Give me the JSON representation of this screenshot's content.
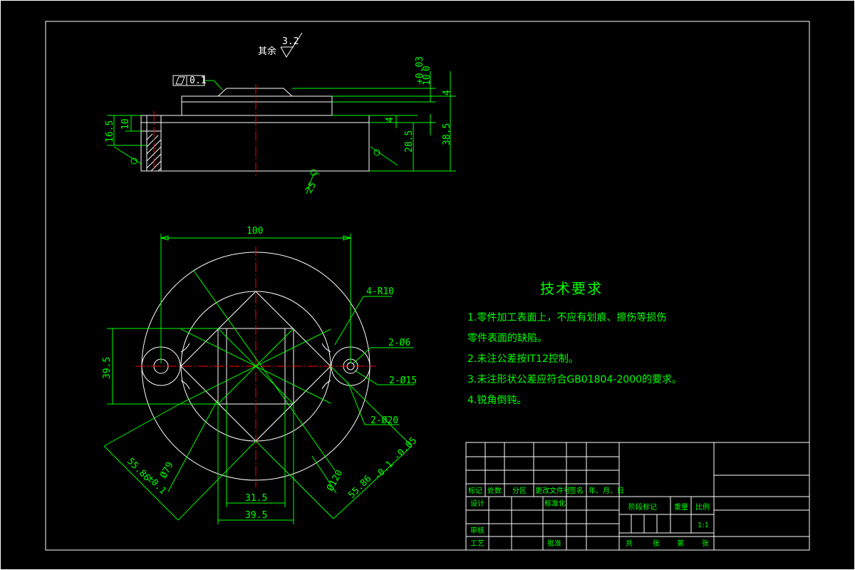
{
  "top_view": {
    "roughness_other_label": "其余",
    "roughness_value": "3.2",
    "flatness_value": "0.1",
    "dim_10_tol": "10",
    "dim_tol_upper": "+0.03",
    "dim_tol_lower": "0",
    "dim_4_top": "4",
    "dim_4_mid": "4",
    "dim_16_5": "16.5",
    "dim_10_left": "10",
    "dim_28_5": "28.5",
    "dim_38_5": "38.5",
    "angle_25": "25"
  },
  "plan_view": {
    "dim_100": "100",
    "dim_4_r10": "4-R10",
    "dim_2_phi6": "2-Ø6",
    "dim_2_phi15": "2-Ø15",
    "dim_2_phi20": "2-Ø20",
    "dim_39_5_left": "39.5",
    "dim_phi79": "Ø79",
    "dim_phi120": "Ø120",
    "dim_55_86_left": "55.86",
    "dim_55_86_left_tol": "±0.1",
    "dim_55_86_right": "55.86",
    "dim_55_86_right_tol": "-0.1 -0.05",
    "dim_31_5": "31.5",
    "dim_39_5_bottom": "39.5"
  },
  "technical_requirements": {
    "title": "技术要求",
    "items": [
      "1.零件加工表面上，不应有划痕、擦伤等损伤",
      "零件表面的缺陷。",
      "2.未注公差按IT12控制。",
      "3.未注形状公差应符合GB01804-2000的要求。",
      "4.锐角倒钝。"
    ]
  },
  "title_block": {
    "biaoji": "标记",
    "chushu": "处数",
    "fenqu": "分区",
    "gengai": "更改文件号",
    "qianming": "签名",
    "date": "年、月、日",
    "sheji": "设计",
    "biaozhunhua": "标准化",
    "shenhe": "审核",
    "gongyi": "工艺",
    "pizhun": "批准",
    "jieduan": "阶段标记",
    "zhongliang": "重量",
    "bili": "比例",
    "scale": "1:1",
    "gong": "共",
    "zhang1": "张",
    "di": "第",
    "zhang2": "张"
  },
  "colors": {
    "background": "#000000",
    "geometry": "#ffffff",
    "dimension": "#00ff00",
    "centerline": "#ff0000"
  }
}
